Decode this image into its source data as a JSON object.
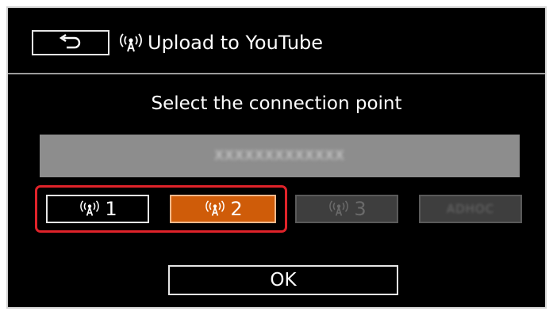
{
  "header": {
    "back_icon": "return-arrow-icon",
    "wifi_icon": "wireless-icon",
    "title": "Upload to YouTube"
  },
  "prompt": "Select the connection point",
  "ssid_field": {
    "value": "XXXXXXXXXXXXX",
    "obscured": true
  },
  "connection_points": [
    {
      "label": "1",
      "icon": "wireless-icon",
      "state": "normal"
    },
    {
      "label": "2",
      "icon": "wireless-icon",
      "state": "selected"
    },
    {
      "label": "3",
      "icon": "wireless-icon",
      "state": "disabled"
    },
    {
      "label": "ADHOC",
      "state": "disabled",
      "obscured": true
    }
  ],
  "ok_button": {
    "label": "OK"
  },
  "colors": {
    "background": "#000000",
    "selected": "#cf5c09",
    "disabled": "#3e3e3e",
    "ssid_field": "#8d8d8d",
    "highlight_frame": "#e0232a"
  }
}
